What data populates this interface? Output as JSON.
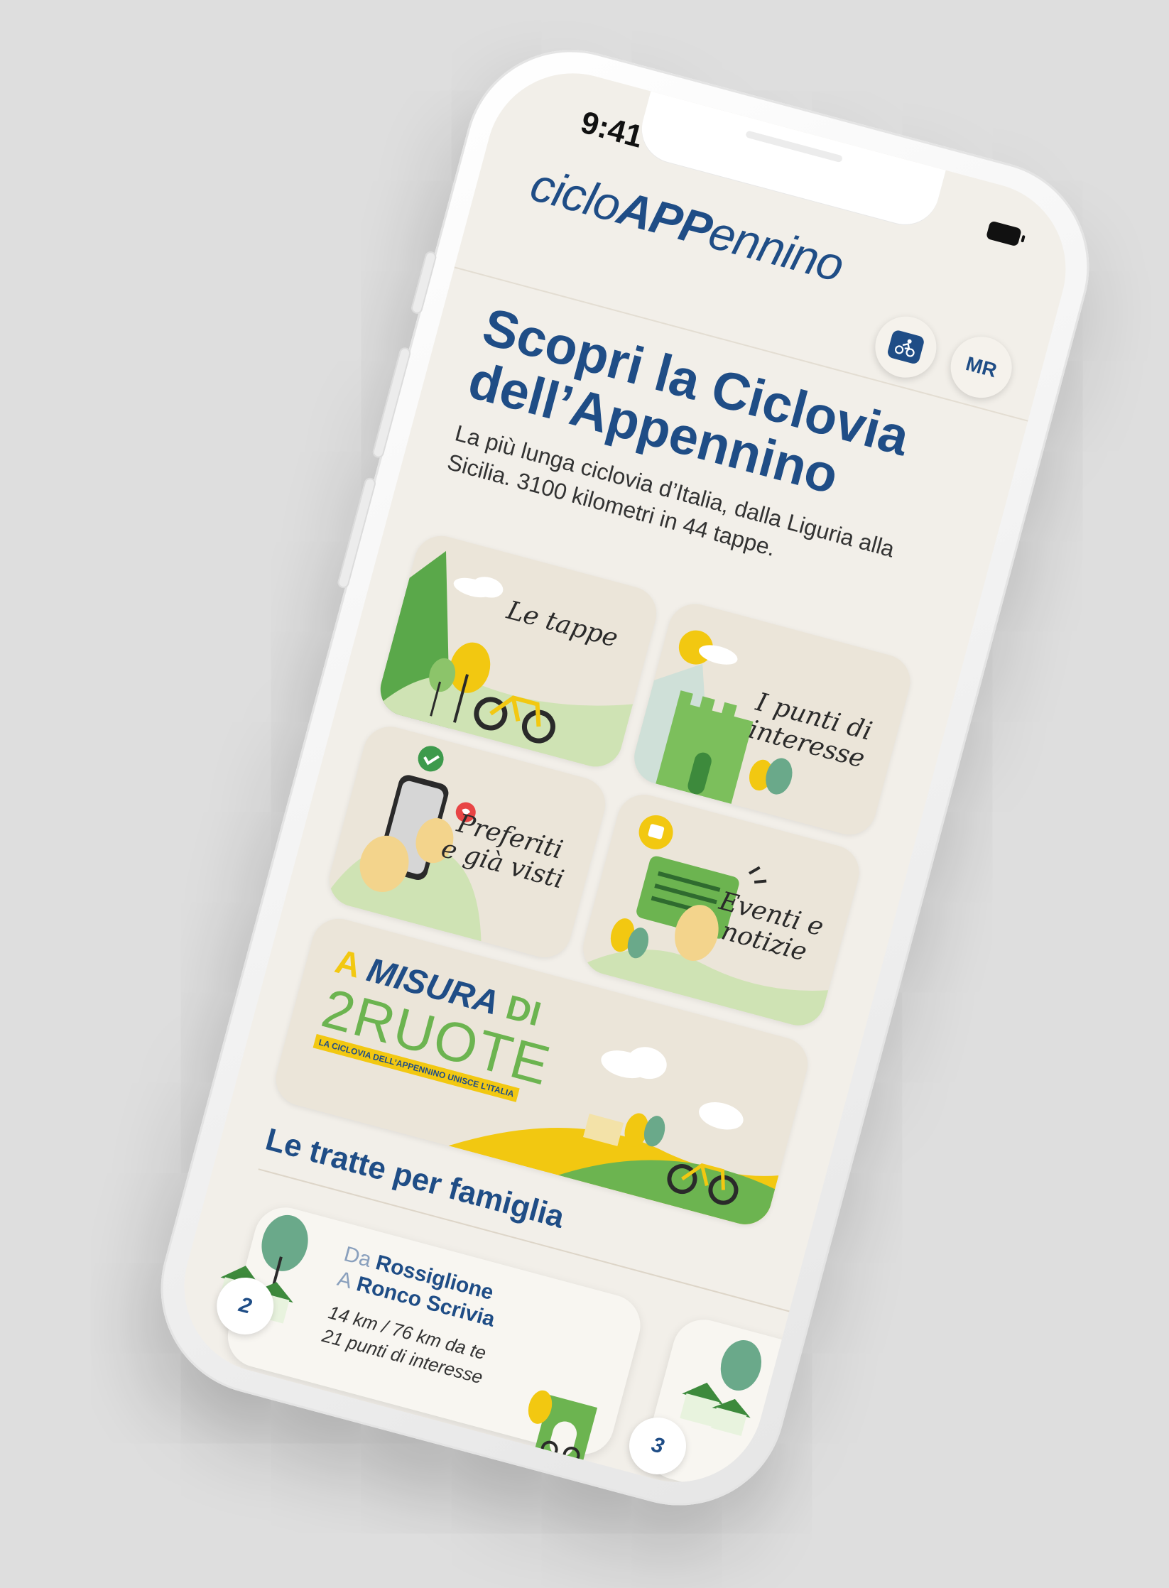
{
  "status_bar": {
    "time": "9:41"
  },
  "header": {
    "logo_prefix": "ciclo",
    "logo_bold": "APP",
    "logo_suffix": "ennino",
    "user_initials": "MR"
  },
  "hero": {
    "title_line1": "Scopri la Ciclovia",
    "title_line2": "dell’Appennino",
    "subtitle": "La più lunga ciclovia d’Italia, dalla Liguria alla Sicilia. 3100 kilometri in 44 tappe."
  },
  "cards": {
    "tappe": {
      "label": "Le tappe"
    },
    "punti": {
      "label_line1": "I punti di",
      "label_line2": "interesse"
    },
    "preferiti": {
      "label_line1": "Preferiti",
      "label_line2": "e già visti"
    },
    "eventi": {
      "label_line1": "Eventi e",
      "label_line2": "notizie"
    },
    "promo": {
      "line1_a": "A",
      "line1_b": "MISURA",
      "line1_c": "DI",
      "line2": "2RUOTE",
      "tagline": "LA CICLOVIA DELL’APPENNINO UNISCE L’ITALIA"
    }
  },
  "section": {
    "title": "Le tratte per famiglia"
  },
  "routes": [
    {
      "number": "2",
      "from_prefix": "Da",
      "from": "Rossiglione",
      "to_prefix": "A",
      "to": "Ronco Scrivia",
      "distance": "14 km / 76 km da te",
      "pois": "21 punti di interesse"
    },
    {
      "number": "3"
    }
  ],
  "colors": {
    "brand_blue": "#1f4d86",
    "accent_yellow": "#f2c811",
    "accent_green": "#6cb450",
    "card_bg": "#ebe5d9",
    "screen_bg": "#f2efe9"
  }
}
